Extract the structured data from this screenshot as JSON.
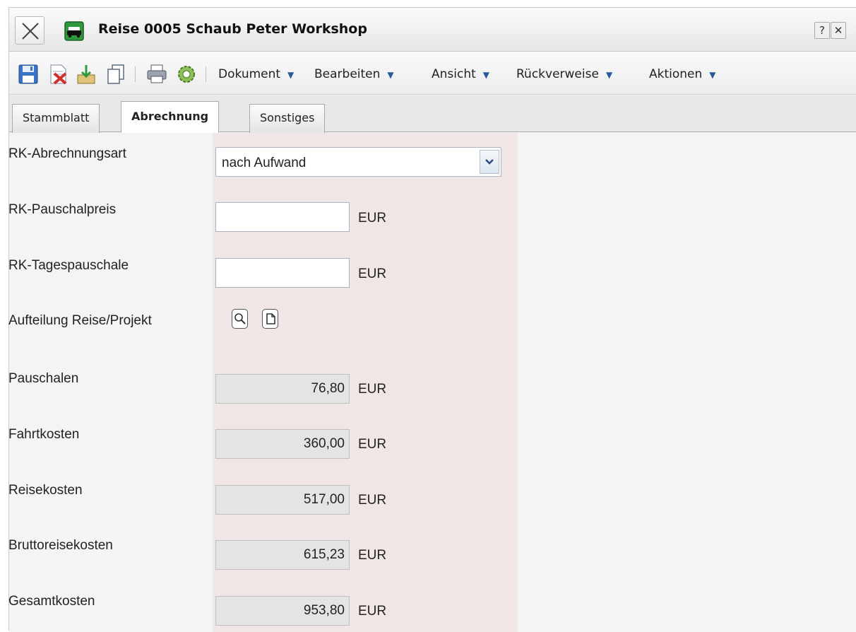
{
  "window": {
    "title": "Reise 0005 Schaub Peter Workshop",
    "help_label": "?",
    "close_label": "✕"
  },
  "toolbar": {
    "icons": [
      "save-icon",
      "delete-icon",
      "import-icon",
      "copy-icon",
      "print-icon",
      "settings-icon"
    ],
    "menus": [
      {
        "label": "Dokument"
      },
      {
        "label": "Bearbeiten"
      },
      {
        "label": "Ansicht"
      },
      {
        "label": "Rückverweise"
      },
      {
        "label": "Aktionen"
      }
    ],
    "menu_arrow": "▼"
  },
  "tabs": [
    {
      "label": "Stammblatt",
      "active": false
    },
    {
      "label": "Abrechnung",
      "active": true
    },
    {
      "label": "Sonstiges",
      "active": false
    }
  ],
  "form": {
    "abrechnungsart": {
      "label": "RK-Abrechnungsart",
      "value": "nach Aufwand"
    },
    "pauschalpreis": {
      "label": "RK-Pauschalpreis",
      "value": "",
      "unit": "EUR"
    },
    "tagespauschale": {
      "label": "RK-Tagespauschale",
      "value": "",
      "unit": "EUR"
    },
    "aufteilung": {
      "label": "Aufteilung Reise/Projekt"
    },
    "pauschalen": {
      "label": "Pauschalen",
      "value": "76,80",
      "unit": "EUR"
    },
    "fahrtkosten": {
      "label": "Fahrtkosten",
      "value": "360,00",
      "unit": "EUR"
    },
    "reisekosten": {
      "label": "Reisekosten",
      "value": "517,00",
      "unit": "EUR"
    },
    "bruttoreisekosten": {
      "label": "Bruttoreisekosten",
      "value": "615,23",
      "unit": "EUR"
    },
    "gesamtkosten": {
      "label": "Gesamtkosten",
      "value": "953,80",
      "unit": "EUR"
    }
  },
  "colors": {
    "field_column_bg": "#f1e6e6",
    "menu_arrow": "#2b5a9b"
  }
}
